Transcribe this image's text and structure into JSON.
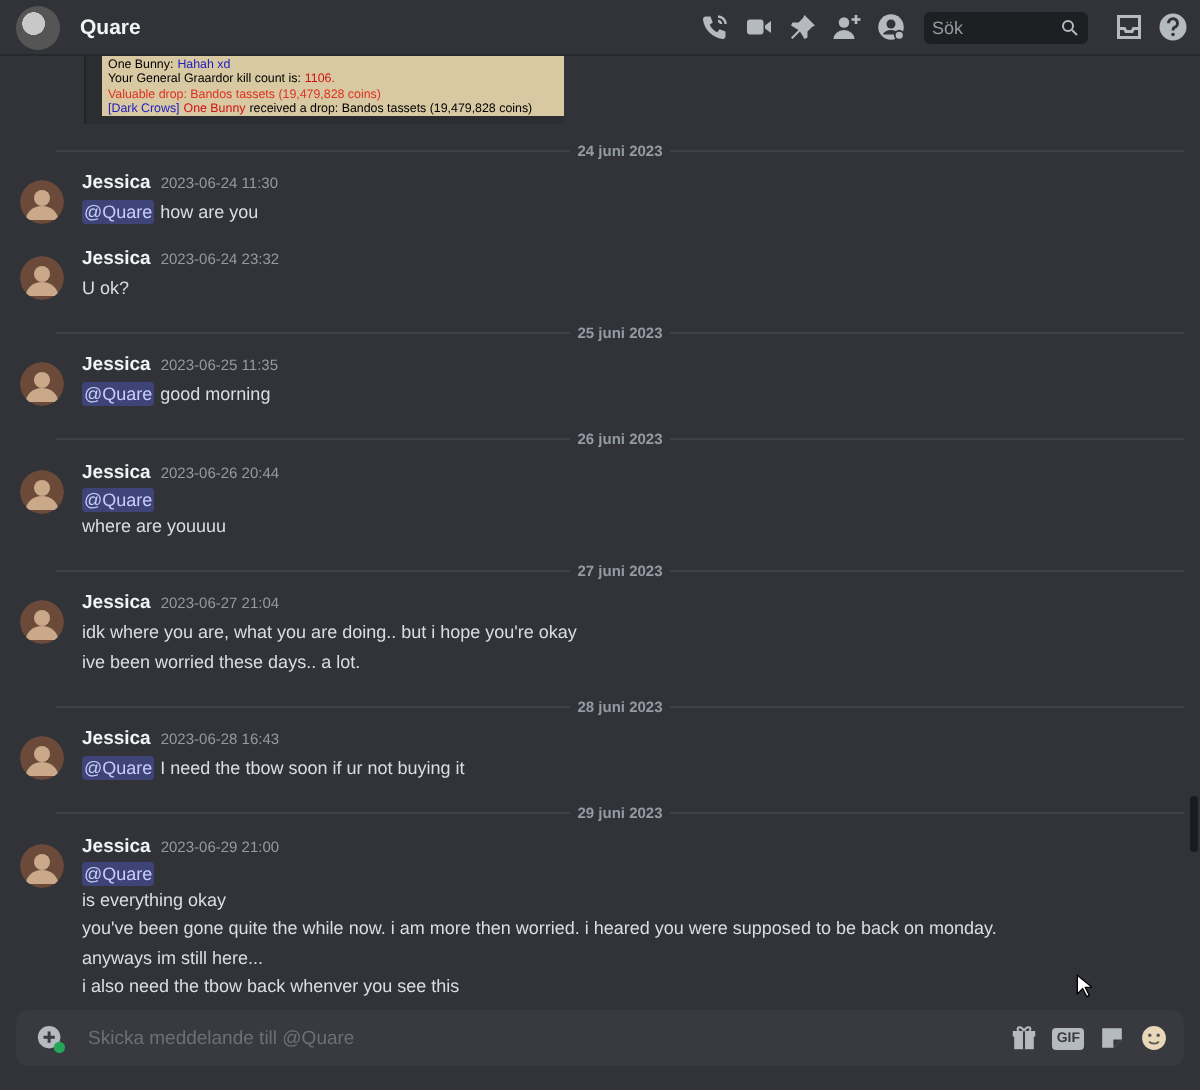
{
  "header": {
    "title": "Quare",
    "search": {
      "placeholder": "Sök"
    }
  },
  "attachment": {
    "lines": [
      [
        {
          "text": "One Bunny: ",
          "color": "#000000"
        },
        {
          "text": "Hahah xd",
          "color": "#2020c0"
        }
      ],
      [
        {
          "text": "Your General Graardor kill count is: ",
          "color": "#000000"
        },
        {
          "text": "1106.",
          "color": "#d01010"
        }
      ],
      [
        {
          "text": "Valuable drop: Bandos tassets (19,479,828 coins)",
          "color": "#e03020"
        }
      ],
      [
        {
          "text": "[Dark Crows]",
          "color": "#2020c0"
        },
        {
          "text": "One Bunny",
          "color": "#d01010"
        },
        {
          "text": " received a drop: Bandos tassets (19,479,828 coins)",
          "color": "#000000"
        }
      ]
    ]
  },
  "feed": [
    {
      "kind": "divider",
      "label": "24 juni 2023"
    },
    {
      "kind": "message",
      "author": "Jessica",
      "timestamp": "2023-06-24 11:30",
      "lines": [
        {
          "mention": "@Quare",
          "text": "how are you"
        }
      ]
    },
    {
      "kind": "message",
      "author": "Jessica",
      "timestamp": "2023-06-24 23:32",
      "lines": [
        {
          "text": "U ok?"
        }
      ]
    },
    {
      "kind": "divider",
      "label": "25 juni 2023"
    },
    {
      "kind": "message",
      "author": "Jessica",
      "timestamp": "2023-06-25 11:35",
      "lines": [
        {
          "mention": "@Quare",
          "text": "good morning"
        }
      ]
    },
    {
      "kind": "divider",
      "label": "26 juni 2023"
    },
    {
      "kind": "message",
      "author": "Jessica",
      "timestamp": "2023-06-26 20:44",
      "lines": [
        {
          "mention": "@Quare"
        },
        {
          "text": "where are youuuu"
        }
      ]
    },
    {
      "kind": "divider",
      "label": "27 juni 2023"
    },
    {
      "kind": "message",
      "author": "Jessica",
      "timestamp": "2023-06-27 21:04",
      "lines": [
        {
          "text": "idk where you are, what you are doing.. but i hope you're okay"
        },
        {
          "text": "ive been worried these days.. a lot."
        }
      ]
    },
    {
      "kind": "divider",
      "label": "28 juni 2023"
    },
    {
      "kind": "message",
      "author": "Jessica",
      "timestamp": "2023-06-28 16:43",
      "lines": [
        {
          "mention": "@Quare",
          "text": "I need the tbow soon if ur not buying it"
        }
      ]
    },
    {
      "kind": "divider",
      "label": "29 juni 2023"
    },
    {
      "kind": "message",
      "author": "Jessica",
      "timestamp": "2023-06-29 21:00",
      "lines": [
        {
          "mention": "@Quare"
        },
        {
          "text": "is everything okay"
        },
        {
          "text": "you've been gone quite the while now. i am more then worried. i heared you were supposed to be back on monday."
        },
        {
          "text": "anyways im still here..."
        },
        {
          "text": "i also need the tbow back whenver you see this"
        }
      ]
    }
  ],
  "composer": {
    "placeholder": "Skicka meddelande till @Quare",
    "gif_label": "GIF"
  }
}
